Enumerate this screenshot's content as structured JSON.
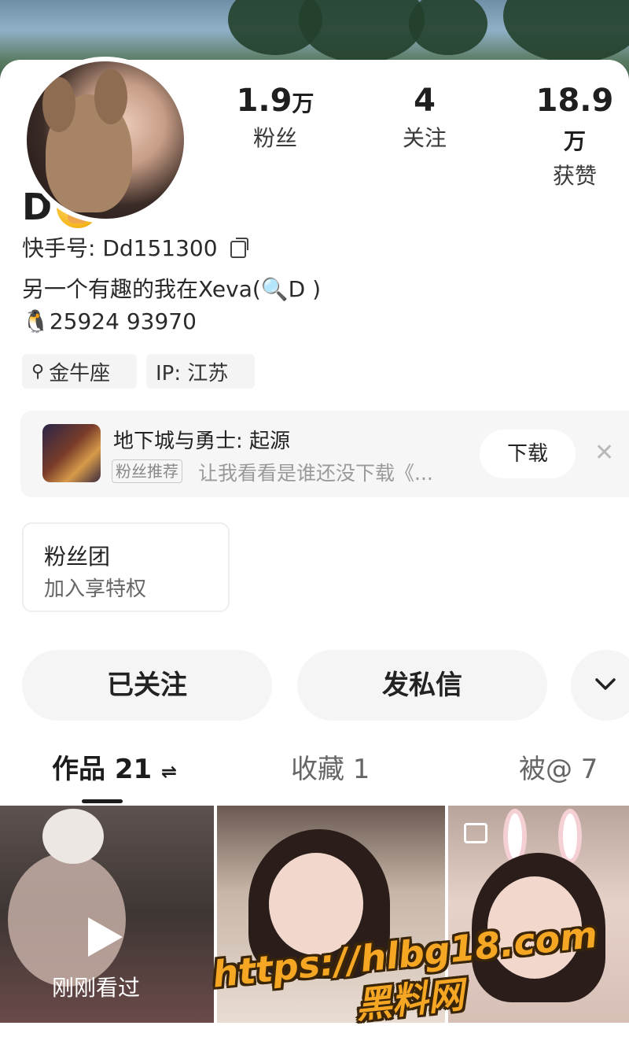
{
  "profile": {
    "name": "D",
    "id_label": "快手号: Dd151300",
    "bio": "另一个有趣的我在Xeva(🔍D )",
    "contact": "🐧25924 93970",
    "tags": [
      "金牛座",
      "IP: 江苏"
    ]
  },
  "stats": [
    {
      "value": "1.9",
      "unit": "万",
      "label": "粉丝"
    },
    {
      "value": "4",
      "unit": "",
      "label": "关注"
    },
    {
      "value": "18.9",
      "unit": "万",
      "label": "获赞"
    }
  ],
  "ad": {
    "title": "地下城与勇士: 起源",
    "badge": "粉丝推荐",
    "subtitle": "让我看看是谁还没下载《...",
    "download_label": "下载",
    "close_glyph": "✕"
  },
  "fan_club": {
    "title": "粉丝团",
    "subtitle": "加入享特权"
  },
  "actions": {
    "followed_label": "已关注",
    "message_label": "发私信"
  },
  "tabs": [
    {
      "label": "作品 21",
      "suffix": "⇌"
    },
    {
      "label": "收藏 1"
    },
    {
      "label": "被@ 7"
    }
  ],
  "grid": {
    "viewed_label": "刚刚看过"
  },
  "watermark": {
    "line1": "https://hlbg18.com",
    "line2": "黑料网"
  },
  "colors": {
    "accent_watermark": "#f5a623",
    "text_primary": "#1f1f1f",
    "background": "#ffffff"
  }
}
